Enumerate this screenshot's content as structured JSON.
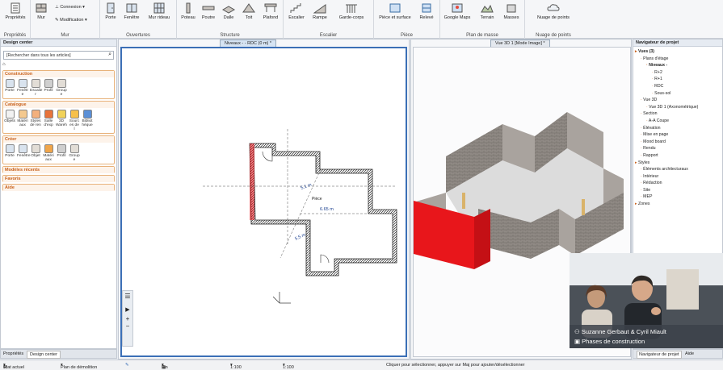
{
  "ribbon": {
    "groups": [
      {
        "label": "Propriétés"
      },
      {
        "label": "Mur"
      },
      {
        "label": "Ouvertures"
      },
      {
        "label": "Structure"
      },
      {
        "label": "Escalier"
      },
      {
        "label": "Pièce"
      },
      {
        "label": "Plan de masse"
      },
      {
        "label": "Nuage de points"
      }
    ],
    "buttons": {
      "proprietes": "Propriétés",
      "mur": "Mur",
      "connexion": "Connexion",
      "modification": "Modification",
      "porte": "Porte",
      "fenetre": "Fenêtre",
      "mur_rideau": "Mur rideau",
      "poteau": "Poteau",
      "poutre": "Poutre",
      "dalle": "Dalle",
      "toit": "Toit",
      "plafond": "Plafond",
      "escalier": "Escalier",
      "rampe": "Rampe",
      "garde_corps": "Garde-corps",
      "piece_surface": "Pièce et surface",
      "releve": "Relevé",
      "google_maps": "Google Maps",
      "terrain": "Terrain",
      "masses": "Masses",
      "nuage": "Nuage de points"
    }
  },
  "design_center": {
    "title": "Design center",
    "search_placeholder": "[Rechercher dans tous les articles]",
    "sections": {
      "construction": {
        "title": "Construction",
        "items": [
          "Porte",
          "Fenêtr e",
          "Escalie r",
          "Profil",
          "Group e"
        ]
      },
      "catalogue": {
        "title": "Catalogue",
        "items": [
          "Objets",
          "Matéri aux",
          "Styles de ren",
          "Salle d'exp",
          "3D Wareh",
          "Sourc es de l",
          "Bibliot hèque"
        ]
      },
      "creer": {
        "title": "Créer",
        "items": [
          "Porte",
          "Fenêtre",
          "Objet",
          "Matéri aux",
          "Profil",
          "Group e"
        ]
      },
      "modeles": "Modèles récents",
      "favoris": "Favoris",
      "aide": "Aide"
    },
    "bottom_tabs": [
      "Propriétés",
      "Design center"
    ]
  },
  "views": {
    "left_tab": "Niveaux - - RDC (0 m) *",
    "right_tab": "Vue 3D 1 [Mode Image] *",
    "dimensions": [
      "6.65 m",
      "5.5 m",
      "5.1 m"
    ],
    "room_label": "Pièce"
  },
  "navigator": {
    "title": "Navigateur de projet",
    "tree": [
      {
        "label": "Vues (3)",
        "level": 0,
        "bold": true
      },
      {
        "label": "Plans d'étage",
        "level": 1
      },
      {
        "label": "Niveaux -",
        "level": 2,
        "bold": true
      },
      {
        "label": "R+2",
        "level": 3
      },
      {
        "label": "R+1",
        "level": 3
      },
      {
        "label": "RDC",
        "level": 3
      },
      {
        "label": "Sous-sol",
        "level": 3
      },
      {
        "label": "Vue 3D",
        "level": 1
      },
      {
        "label": "Vue 3D 1 (Axonométrique)",
        "level": 2
      },
      {
        "label": "Section",
        "level": 1
      },
      {
        "label": "A-A Coupe",
        "level": 2
      },
      {
        "label": "Élévation",
        "level": 1
      },
      {
        "label": "Mise en page",
        "level": 1
      },
      {
        "label": "Mood board",
        "level": 1
      },
      {
        "label": "Rendu",
        "level": 1
      },
      {
        "label": "Rapport",
        "level": 1
      },
      {
        "label": "Styles",
        "level": 0
      },
      {
        "label": "Éléments architecturaux",
        "level": 1
      },
      {
        "label": "Intérieur",
        "level": 1
      },
      {
        "label": "Rédaction",
        "level": 1
      },
      {
        "label": "Site",
        "level": 1
      },
      {
        "label": "MEP",
        "level": 1
      },
      {
        "label": "Zones",
        "level": 0
      }
    ],
    "bottom_tabs": [
      "Navigateur de projet",
      "Aide"
    ]
  },
  "webcam": {
    "names": "Suzanne Gerbaut & Cyril Miault",
    "subtitle": "Phases de construction"
  },
  "statusbar": {
    "etat": "État actuel",
    "plan": "Plan de démolition",
    "fin": "Fin",
    "scale1": "1:100",
    "scale2": "1:100",
    "hint": "Cliquer pour sélectionner, appuyer sur Maj pour ajouter/désélectionner"
  },
  "colors": {
    "accent": "#c8601a",
    "wall_red": "#e8161b",
    "wall_brick": "#8a8480",
    "tab_blue": "#d6e4f3"
  }
}
